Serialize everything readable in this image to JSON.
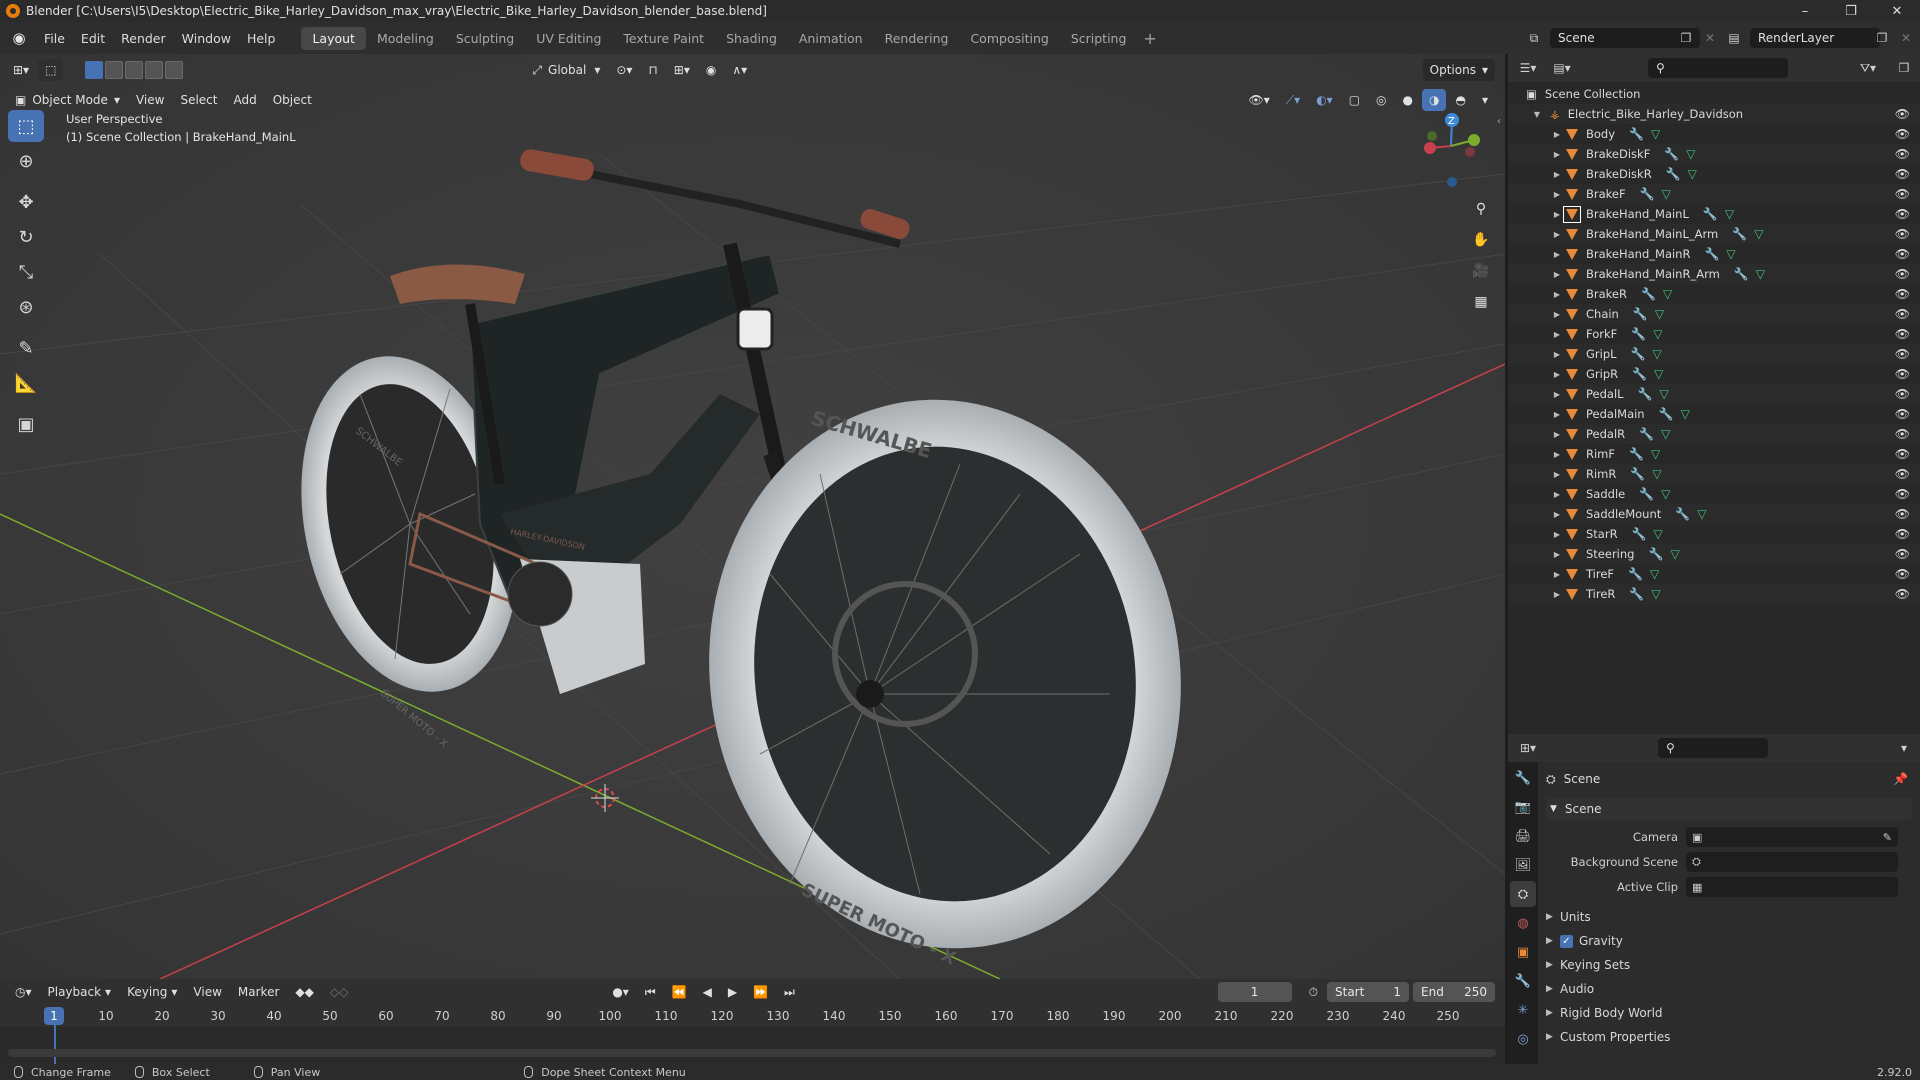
{
  "window": {
    "title": "Blender [C:\\Users\\I5\\Desktop\\Electric_Bike_Harley_Davidson_max_vray\\Electric_Bike_Harley_Davidson_blender_base.blend]",
    "minimize": "–",
    "maximize": "❐",
    "close": "✕"
  },
  "menubar": {
    "items": [
      "File",
      "Edit",
      "Render",
      "Window",
      "Help"
    ],
    "workspaces": [
      "Layout",
      "Modeling",
      "Sculpting",
      "UV Editing",
      "Texture Paint",
      "Shading",
      "Animation",
      "Rendering",
      "Compositing",
      "Scripting"
    ],
    "active_workspace": "Layout",
    "scene_name": "Scene",
    "view_layer": "RenderLayer"
  },
  "viewport_header": {
    "mode": "Object Mode",
    "menus": [
      "View",
      "Select",
      "Add",
      "Object"
    ],
    "transform_orientation": "Global",
    "options_label": "Options"
  },
  "viewport": {
    "perspective": "User Perspective",
    "collection_info": "(1) Scene Collection | BrakeHand_MainL",
    "tire_text_front_top": "SCHWALBE",
    "tire_text_front_bottom": "SUPER MOTO - X",
    "tire_text_rear_top": "SCHWALBE",
    "tire_text_rear_bottom": "SUPER MOTO - X",
    "frame_text": "HARLEY-DAVIDSON",
    "gizmo_axis": "Z"
  },
  "outliner": {
    "root": "Scene Collection",
    "collection": "Electric_Bike_Harley_Davidson",
    "objects": [
      "Body",
      "BrakeDiskF",
      "BrakeDiskR",
      "BrakeF",
      "BrakeHand_MainL",
      "BrakeHand_MainL_Arm",
      "BrakeHand_MainR",
      "BrakeHand_MainR_Arm",
      "BrakeR",
      "Chain",
      "ForkF",
      "GripL",
      "GripR",
      "PedalL",
      "PedalMain",
      "PedalR",
      "RimF",
      "RimR",
      "Saddle",
      "SaddleMount",
      "StarR",
      "Steering",
      "TireF",
      "TireR"
    ],
    "selected": "BrakeHand_MainL"
  },
  "properties": {
    "context": "Scene",
    "panel": "Scene",
    "fields": [
      {
        "label": "Camera",
        "value": ""
      },
      {
        "label": "Background Scene",
        "value": ""
      },
      {
        "label": "Active Clip",
        "value": ""
      }
    ],
    "sections": [
      "Units",
      "Gravity",
      "Keying Sets",
      "Audio",
      "Rigid Body World",
      "Custom Properties"
    ],
    "gravity_checked": true
  },
  "timeline": {
    "menus": [
      "Playback",
      "Keying",
      "View",
      "Marker"
    ],
    "current_frame": "1",
    "start_label": "Start",
    "start": "1",
    "end_label": "End",
    "end": "250",
    "ticks": [
      "1",
      "10",
      "20",
      "30",
      "40",
      "50",
      "60",
      "70",
      "80",
      "90",
      "100",
      "110",
      "120",
      "130",
      "140",
      "150",
      "160",
      "170",
      "180",
      "190",
      "200",
      "210",
      "220",
      "230",
      "240",
      "250"
    ]
  },
  "statusbar": {
    "items": [
      "Change Frame",
      "Box Select",
      "Pan View",
      "Dope Sheet Context Menu"
    ],
    "version": "2.92.0"
  },
  "colors": {
    "accent": "#4772b3",
    "object_orange": "#e88a37",
    "mesh_green": "#3fc37a",
    "axis_x_red": "#c8404e",
    "axis_y_green": "#7bac2d"
  }
}
